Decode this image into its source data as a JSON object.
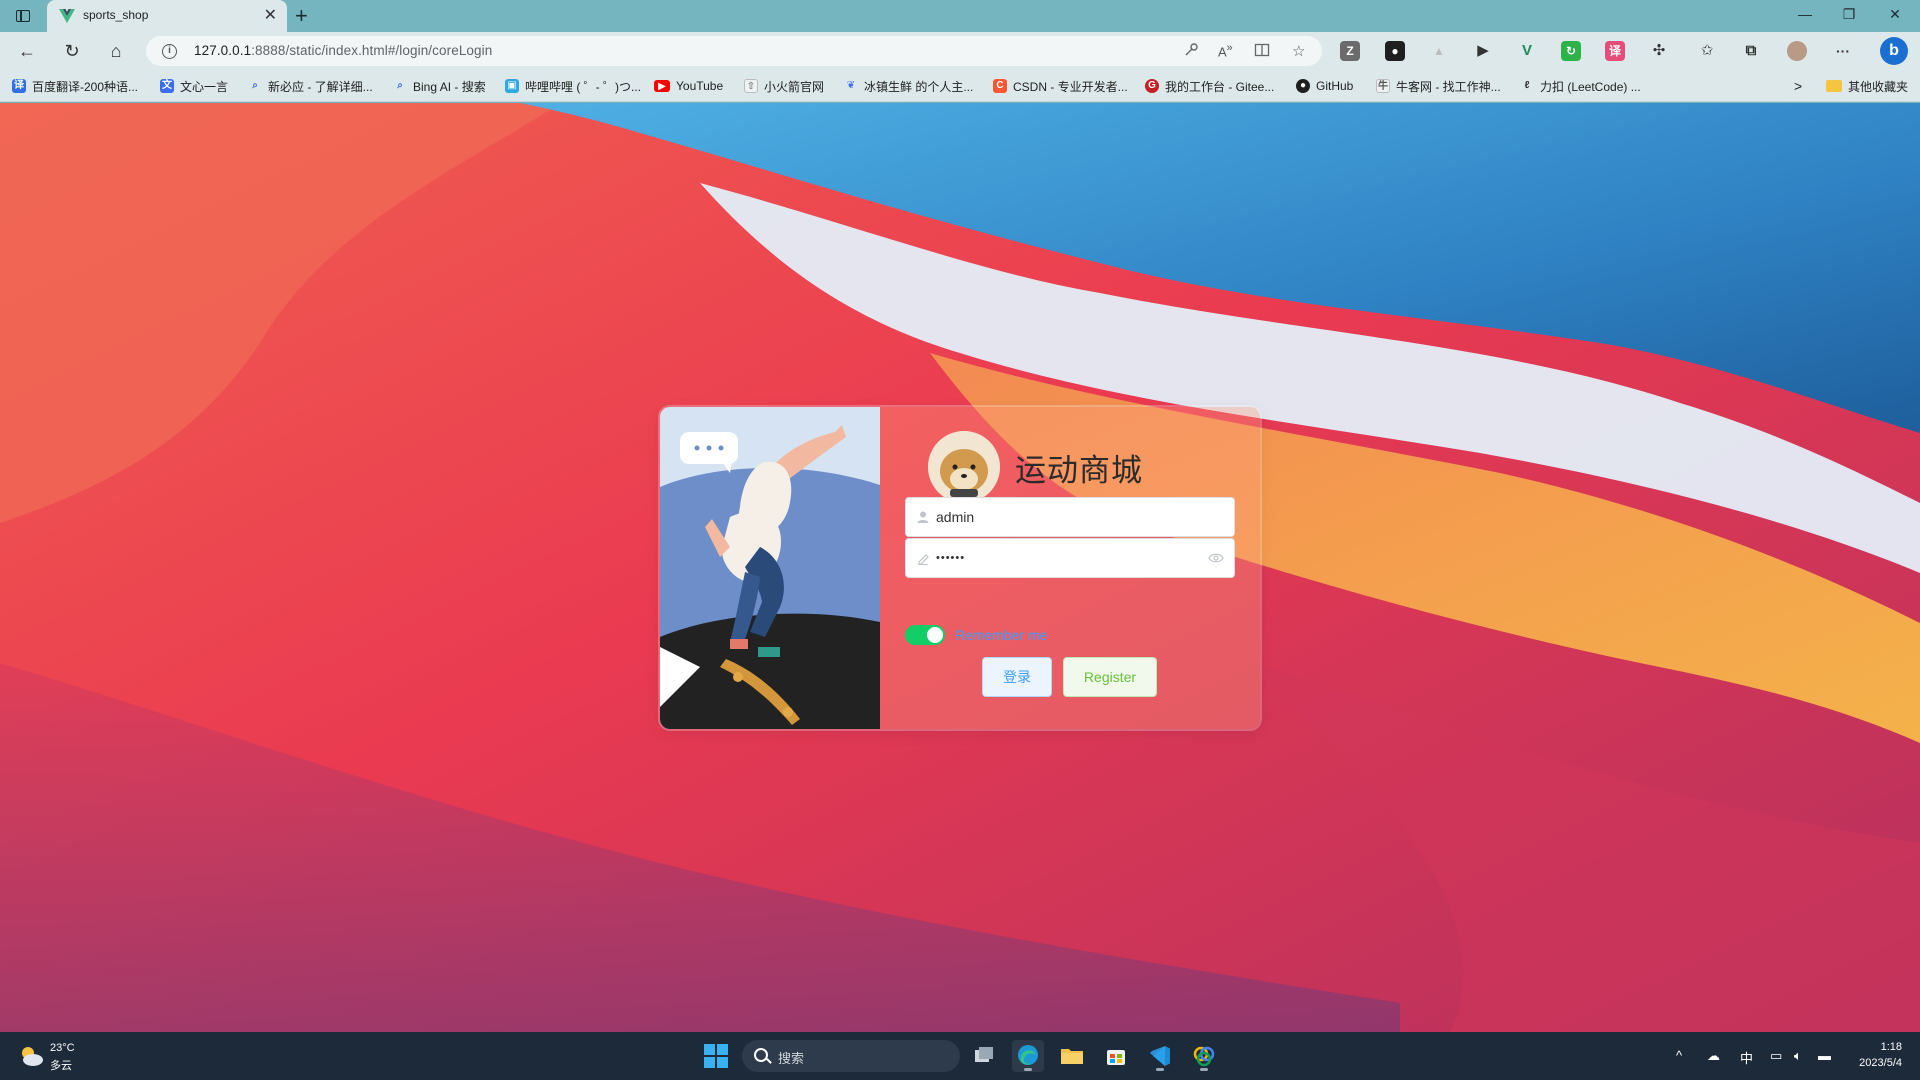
{
  "browser": {
    "tab": {
      "title": "sports_shop",
      "close": "✕"
    },
    "new_tab": "+",
    "window_controls": {
      "minimize": "—",
      "restore": "❐",
      "close": "✕"
    },
    "nav": {
      "back": "←",
      "reload": "↻",
      "home": "⌂",
      "more": "···"
    },
    "address": {
      "host": "127.0.0.1",
      "rest": ":8888/static/index.html#/login/coreLogin"
    },
    "bookmarks": [
      {
        "label": "百度翻译-200种语...",
        "icon": "baidu-translate-icon",
        "color": "#2f6ee5"
      },
      {
        "label": "文心一言",
        "icon": "wenxin-icon",
        "color": "#3a6df0"
      },
      {
        "label": "新必应 - 了解详细...",
        "icon": "search-icon",
        "color": "#3a6df0"
      },
      {
        "label": "Bing AI - 搜索",
        "icon": "search-icon",
        "color": "#3a6df0"
      },
      {
        "label": "哔哩哔哩 ( ゜- ゜)つ...",
        "icon": "bilibili-icon",
        "color": "#2fa9e0"
      },
      {
        "label": "YouTube",
        "icon": "youtube-icon",
        "color": "#ff0000"
      },
      {
        "label": "小火箭官网",
        "icon": "rocket-icon",
        "color": "#9aa7b5"
      },
      {
        "label": "冰镇生鲜 的个人主...",
        "icon": "leaf-icon",
        "color": "#3a6df0"
      },
      {
        "label": "CSDN - 专业开发者...",
        "icon": "csdn-icon",
        "color": "#fc5531"
      },
      {
        "label": "我的工作台 - Gitee...",
        "icon": "gitee-icon",
        "color": "#c71d23"
      },
      {
        "label": "GitHub",
        "icon": "github-icon",
        "color": "#1f1f1f"
      },
      {
        "label": "牛客网 - 找工作神...",
        "icon": "nowcoder-icon",
        "color": "#6a6a6a"
      },
      {
        "label": "力扣 (LeetCode) ...",
        "icon": "leetcode-icon",
        "color": "#333333"
      }
    ],
    "bookmarks_more": ">",
    "bookmarks_folder": "其他收藏夹"
  },
  "login": {
    "title": "运动商城",
    "username_value": "admin",
    "password_value": "••••••",
    "remember_label": "Remember me",
    "remember_on": true,
    "login_button": "登录",
    "register_button": "Register",
    "colors": {
      "switch_on": "#13ce66",
      "login_blue": "#409eff",
      "register_green": "#67c23a"
    }
  },
  "taskbar": {
    "weather_temp": "23°C",
    "weather_desc": "多云",
    "search_placeholder": "搜索",
    "tray": {
      "chevron": "^",
      "ime": "中"
    },
    "time": "1:18",
    "date": "2023/5/4"
  }
}
